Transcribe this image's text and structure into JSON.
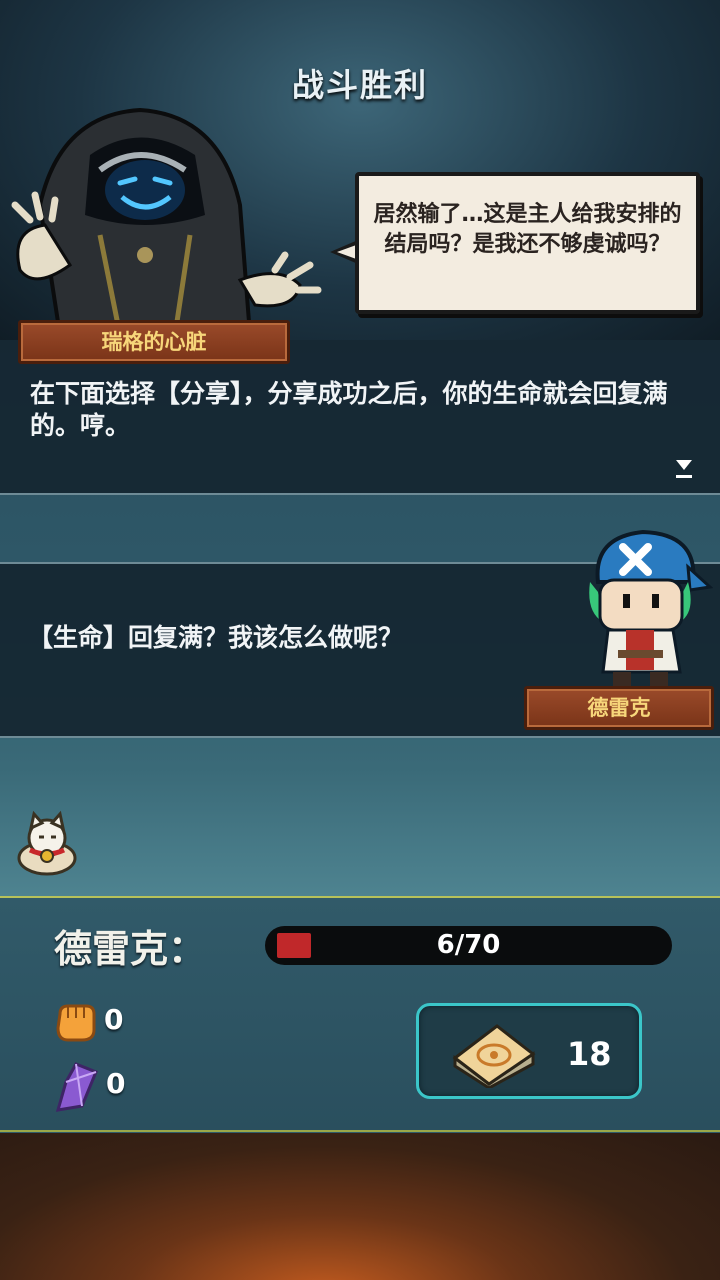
{
  "title": "战斗胜利",
  "villain": {
    "speech": "居然输了…这是主人给我安排的结局吗？是我还不够虔诚吗？",
    "name": "瑞格的心脏"
  },
  "dialog1": {
    "text": "在下面选择【分享】，分享成功之后，你的生命就会回复满的。哼。"
  },
  "dialog2": {
    "text": "【生命】回复满？我该怎么做呢？",
    "speaker": "德雷克"
  },
  "player": {
    "name_label": "德雷克：",
    "hp_text": "6/70",
    "hp_current": 6,
    "hp_max": 70,
    "attack": "0",
    "defense": "0",
    "cards": "18"
  },
  "colors": {
    "hp": "#c0282a",
    "accent": "#3bc6c9",
    "nameplate": "#7a3418"
  }
}
